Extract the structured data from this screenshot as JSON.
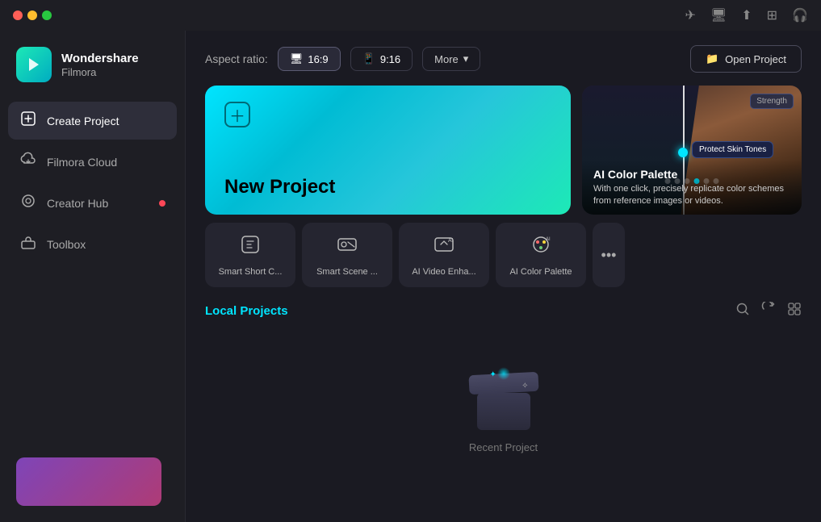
{
  "app": {
    "name": "Wondershare",
    "sub": "Filmora"
  },
  "titlebar": {
    "icons": [
      "navigation-icon",
      "grid-icon",
      "download-icon",
      "layout-icon",
      "headset-icon"
    ]
  },
  "sidebar": {
    "items": [
      {
        "id": "create-project",
        "label": "Create Project",
        "icon": "➕",
        "active": true,
        "dot": false
      },
      {
        "id": "filmora-cloud",
        "label": "Filmora Cloud",
        "icon": "☁️",
        "active": false,
        "dot": false
      },
      {
        "id": "creator-hub",
        "label": "Creator Hub",
        "icon": "💡",
        "active": false,
        "dot": true
      },
      {
        "id": "toolbox",
        "label": "Toolbox",
        "icon": "🧰",
        "active": false,
        "dot": false
      }
    ]
  },
  "topbar": {
    "aspect_label": "Aspect ratio:",
    "aspect_options": [
      {
        "label": "16:9",
        "icon": "🖥",
        "active": true
      },
      {
        "label": "9:16",
        "icon": "📱",
        "active": false
      }
    ],
    "more_label": "More",
    "open_project_label": "Open Project"
  },
  "new_project": {
    "label": "New Project"
  },
  "ai_promo": {
    "title": "AI Color Palette",
    "description": "With one click, precisely replicate color schemes from reference images or videos.",
    "tag": "Strength",
    "skin_label": "Protect Skin Tones",
    "dots": [
      false,
      false,
      false,
      true,
      false,
      false
    ]
  },
  "tools": [
    {
      "id": "smart-short-clip",
      "label": "Smart Short C...",
      "icon": "📱"
    },
    {
      "id": "smart-scene",
      "label": "Smart Scene ...",
      "icon": "🎬"
    },
    {
      "id": "ai-video-enhance",
      "label": "AI Video Enha...",
      "icon": "✨"
    },
    {
      "id": "ai-color-palette",
      "label": "AI Color Palette",
      "icon": "🎨"
    }
  ],
  "local_projects": {
    "title": "Local Projects",
    "empty_label": "Recent Project"
  }
}
